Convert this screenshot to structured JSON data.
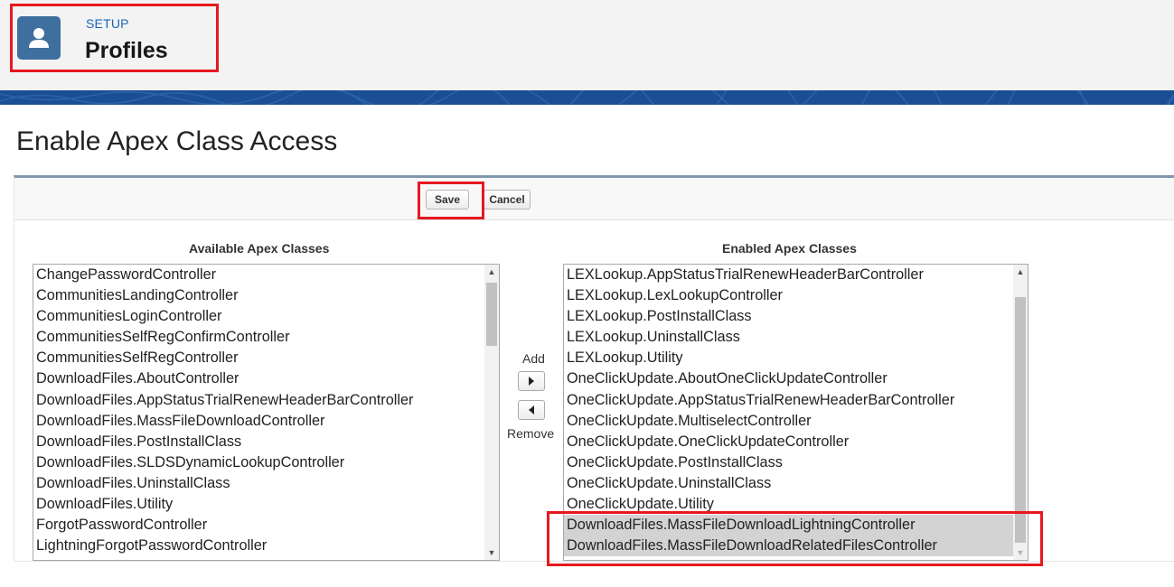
{
  "header": {
    "eyebrow": "SETUP",
    "title": "Profiles",
    "icon": "user-profile-icon"
  },
  "page": {
    "title": "Enable Apex Class Access"
  },
  "toolbar": {
    "save_label": "Save",
    "cancel_label": "Cancel"
  },
  "available": {
    "label": "Available Apex Classes",
    "items": [
      "ChangePasswordController",
      "CommunitiesLandingController",
      "CommunitiesLoginController",
      "CommunitiesSelfRegConfirmController",
      "CommunitiesSelfRegController",
      "DownloadFiles.AboutController",
      "DownloadFiles.AppStatusTrialRenewHeaderBarController",
      "DownloadFiles.MassFileDownloadController",
      "DownloadFiles.PostInstallClass",
      "DownloadFiles.SLDSDynamicLookupController",
      "DownloadFiles.UninstallClass",
      "DownloadFiles.Utility",
      "ForgotPasswordController",
      "LightningForgotPasswordController"
    ]
  },
  "enabled": {
    "label": "Enabled Apex Classes",
    "items": [
      "LEXLookup.AppStatusTrialRenewHeaderBarController",
      "LEXLookup.LexLookupController",
      "LEXLookup.PostInstallClass",
      "LEXLookup.UninstallClass",
      "LEXLookup.Utility",
      "OneClickUpdate.AboutOneClickUpdateController",
      "OneClickUpdate.AppStatusTrialRenewHeaderBarController",
      "OneClickUpdate.MultiselectController",
      "OneClickUpdate.OneClickUpdateController",
      "OneClickUpdate.PostInstallClass",
      "OneClickUpdate.UninstallClass",
      "OneClickUpdate.Utility",
      "DownloadFiles.MassFileDownloadLightningController",
      "DownloadFiles.MassFileDownloadRelatedFilesController"
    ],
    "selected_items": [
      "DownloadFiles.MassFileDownloadLightningController",
      "DownloadFiles.MassFileDownloadRelatedFilesController"
    ]
  },
  "transfer": {
    "add_label": "Add",
    "remove_label": "Remove",
    "add_icon": "arrow-right-icon",
    "remove_icon": "arrow-left-icon"
  },
  "colors": {
    "brand": "#3e6f9e",
    "banner": "#1b4f94",
    "highlight": "#e6191f",
    "eyebrow": "#1c64b8",
    "selected_row": "#d3d3d3"
  }
}
